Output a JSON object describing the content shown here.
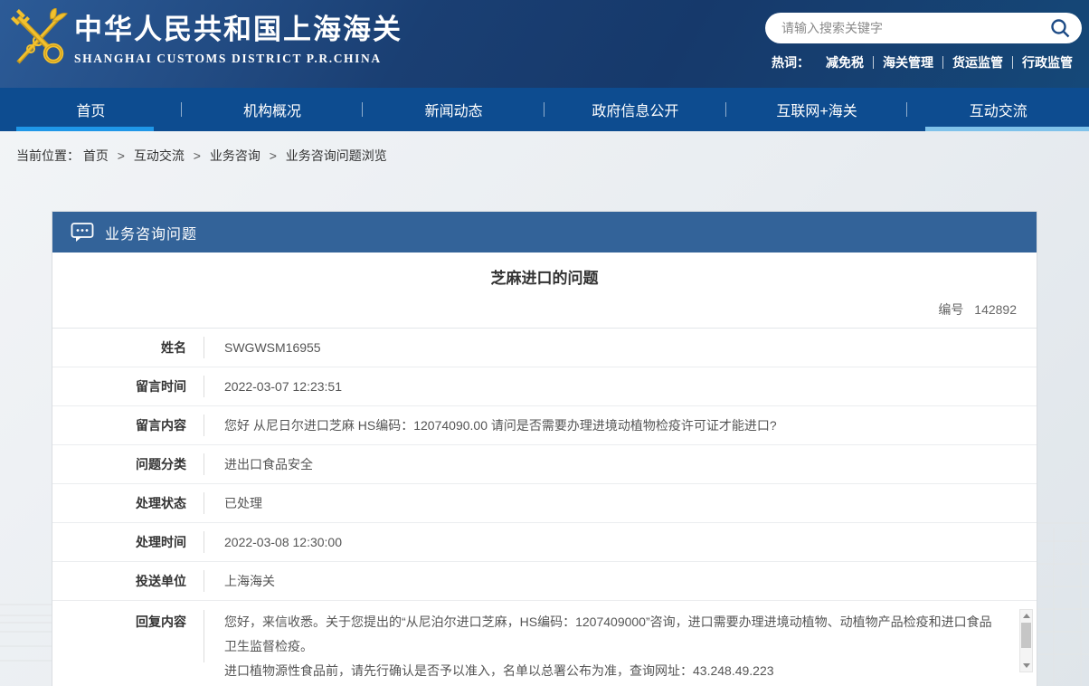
{
  "header": {
    "site_title_cn": "中华人民共和国上海海关",
    "site_title_en": "SHANGHAI CUSTOMS DISTRICT P.R.CHINA",
    "search": {
      "placeholder": "请输入搜索关键字"
    },
    "hot_words": {
      "label": "热词：",
      "items": [
        "减免税",
        "海关管理",
        "货运监管",
        "行政监管"
      ]
    }
  },
  "nav": {
    "items": [
      {
        "label": "首页"
      },
      {
        "label": "机构概况"
      },
      {
        "label": "新闻动态"
      },
      {
        "label": "政府信息公开"
      },
      {
        "label": "互联网+海关"
      },
      {
        "label": "互动交流"
      }
    ]
  },
  "breadcrumb": {
    "prefix": "当前位置：",
    "separator": ">",
    "items": [
      "首页",
      "互动交流",
      "业务咨询",
      "业务咨询问题浏览"
    ]
  },
  "panel": {
    "header_label": "业务咨询问题",
    "title": "芝麻进口的问题",
    "number_label": "编号",
    "number_value": "142892",
    "rows": [
      {
        "label": "姓名",
        "value": "SWGWSM16955"
      },
      {
        "label": "留言时间",
        "value": "2022-03-07 12:23:51"
      },
      {
        "label": "留言内容",
        "value": "您好 从尼日尔进口芝麻 HS编码：12074090.00 请问是否需要办理进境动植物检疫许可证才能进口?"
      },
      {
        "label": "问题分类",
        "value": "进出口食品安全"
      },
      {
        "label": "处理状态",
        "value": "已处理"
      },
      {
        "label": "处理时间",
        "value": "2022-03-08 12:30:00"
      },
      {
        "label": "投送单位",
        "value": "上海海关"
      }
    ],
    "reply": {
      "label": "回复内容",
      "lines": [
        "您好，来信收悉。关于您提出的“从尼泊尔进口芝麻，HS编码：1207409000”咨询，进口需要办理进境动植物、动植物产品检疫和进口食品卫生监督检疫。",
        "进口植物源性食品前，请先行确认是否予以准入，名单以总署公布为准，查询网址：43.248.49.223"
      ]
    }
  },
  "colors": {
    "banner_navy": "#1a3f73",
    "nav_blue": "#0d4c90",
    "active_underline": "#1f97e8",
    "section_underline": "#7fc2ea",
    "panel_header_blue": "#336399",
    "emblem_gold": "#f2c12e"
  }
}
